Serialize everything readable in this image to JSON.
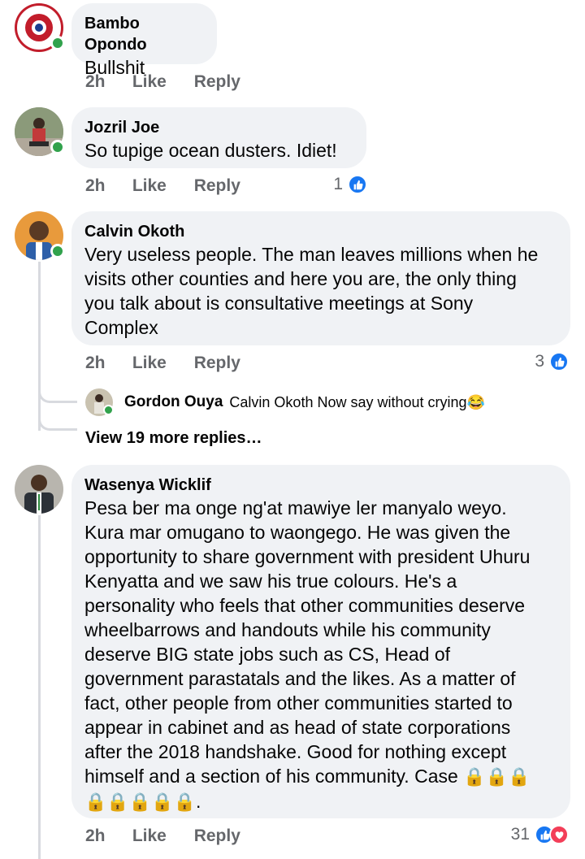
{
  "comments": [
    {
      "author": "Bambo Opondo",
      "text": "Bullshit",
      "time": "2h",
      "like": "Like",
      "reply": "Reply",
      "reactions": ""
    },
    {
      "author": "Jozril Joe",
      "text": "So tupige ocean dusters. Idiet!",
      "time": "2h",
      "like": "Like",
      "reply": "Reply",
      "reactions": "1"
    },
    {
      "author": "Calvin Okoth",
      "text_lines": [
        "Very useless people. The man leaves millions when he",
        "visits other counties and here you are, the only thing",
        "you talk about is consultative meetings at Sony",
        "Complex"
      ],
      "time": "2h",
      "like": "Like",
      "reply": "Reply",
      "reactions": "3",
      "reply_preview": {
        "author": "Gordon Ouya",
        "text": "Calvin Okoth Now say without crying",
        "emoji": "😂"
      },
      "view_more": "View 19 more replies…"
    },
    {
      "author": "Wasenya Wicklif",
      "text_lines": [
        "Pesa ber ma onge ng'at mawiye ler manyalo weyo.",
        "Kura mar omugano to waongego. He was given the",
        "opportunity to share government with president Uhuru",
        "Kenyatta and we saw his true colours. He's a",
        "personality who feels that other communities deserve",
        "wheelbarrows and handouts while his community",
        "deserve BIG state jobs such as CS, Head of",
        "government parastatals and the likes. As a matter of",
        "fact, other people from other communities started to",
        "appear in cabinet and as head of state corporations",
        "after the 2018 handshake. Good for nothing except",
        "himself and a section of his community. Case"
      ],
      "lock_emoji": "🔒",
      "trailing": ".",
      "time": "2h",
      "like": "Like",
      "reply": "Reply",
      "reactions": "31"
    }
  ],
  "colors": {
    "bubble": "#f0f2f5",
    "online": "#31a24c",
    "like_blue": "#1877f2",
    "love_red": "#f33e58",
    "meta_gray": "#65676b"
  }
}
